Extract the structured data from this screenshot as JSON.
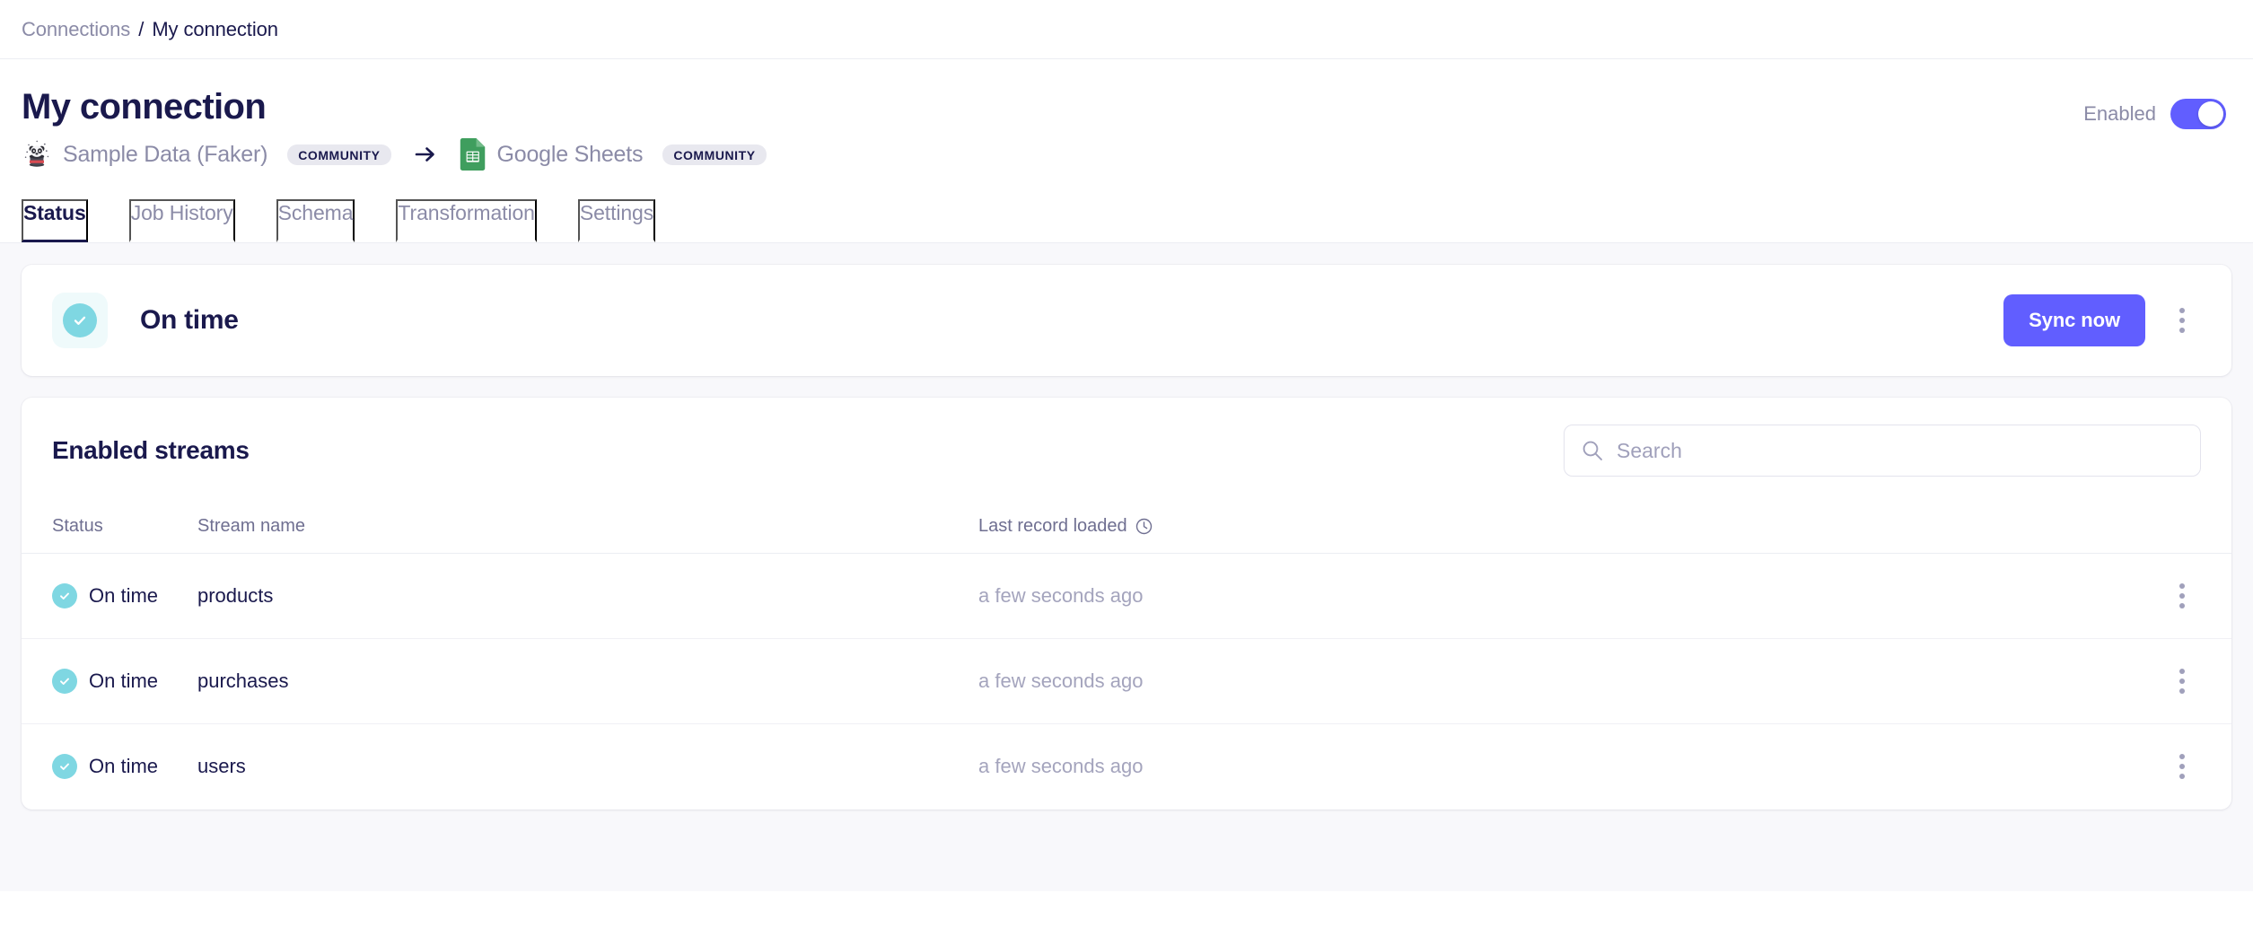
{
  "breadcrumb": {
    "parent": "Connections",
    "separator": "/",
    "current": "My connection"
  },
  "header": {
    "title": "My connection",
    "enabled_label": "Enabled",
    "enabled_state": "on",
    "source": {
      "name": "Sample Data (Faker)",
      "badge": "COMMUNITY",
      "icon": "faker-panda-icon"
    },
    "arrow": "arrow-right-icon",
    "destination": {
      "name": "Google Sheets",
      "badge": "COMMUNITY",
      "icon": "google-sheets-icon"
    }
  },
  "tabs": [
    {
      "label": "Status",
      "active": true
    },
    {
      "label": "Job History",
      "active": false
    },
    {
      "label": "Schema",
      "active": false
    },
    {
      "label": "Transformation",
      "active": false
    },
    {
      "label": "Settings",
      "active": false
    }
  ],
  "status_card": {
    "icon": "check-circle-icon",
    "title": "On time",
    "sync_label": "Sync now",
    "menu_icon": "kebab-menu-icon"
  },
  "streams": {
    "title": "Enabled streams",
    "search_placeholder": "Search",
    "search_value": "",
    "search_icon": "search-icon",
    "columns": {
      "status": "Status",
      "name": "Stream name",
      "last_record": "Last record loaded",
      "last_record_icon": "clock-icon"
    },
    "rows": [
      {
        "status": "On time",
        "name": "products",
        "last_record": "a few seconds ago"
      },
      {
        "status": "On time",
        "name": "purchases",
        "last_record": "a few seconds ago"
      },
      {
        "status": "On time",
        "name": "users",
        "last_record": "a few seconds ago"
      }
    ]
  },
  "colors": {
    "accent": "#615eff",
    "success": "#7fd7e2",
    "text_dark": "#1a194d",
    "text_muted": "#8b8ba7",
    "page_bg": "#f8f8fb"
  }
}
